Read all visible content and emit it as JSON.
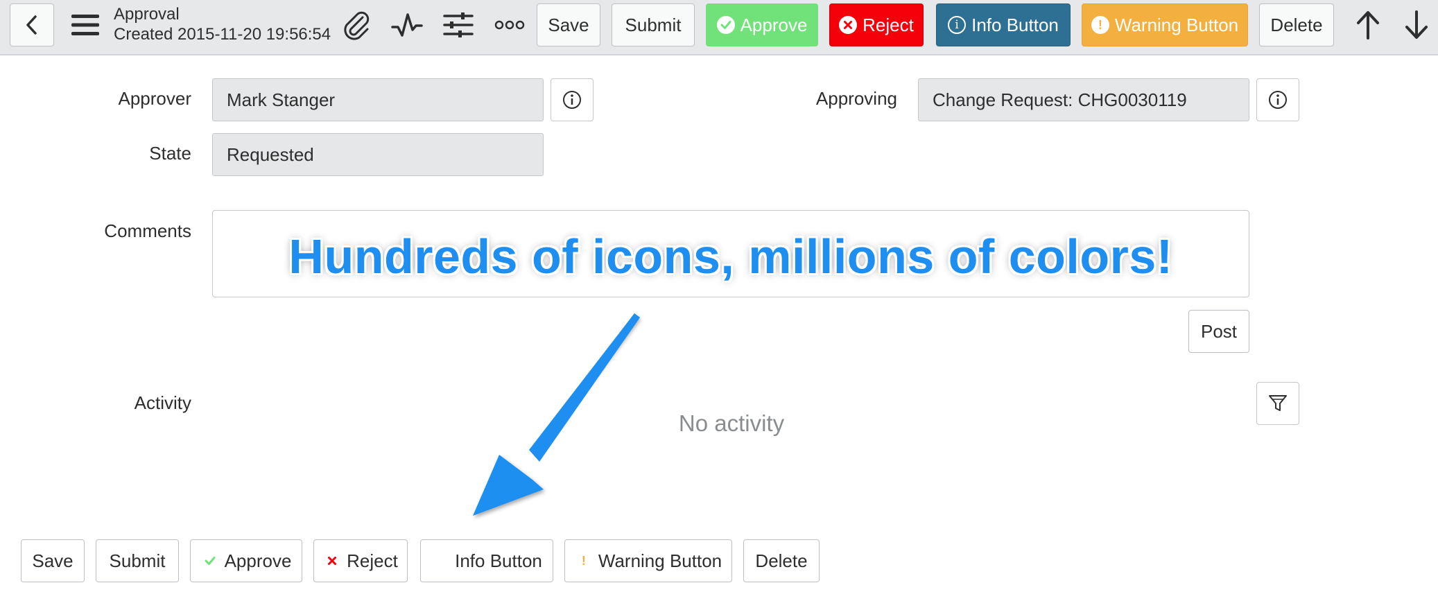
{
  "header": {
    "title": "Approval",
    "subtitle": "Created 2015-11-20 19:56:54",
    "buttons": {
      "save": "Save",
      "submit": "Submit",
      "approve": "Approve",
      "reject": "Reject",
      "info": "Info Button",
      "warning": "Warning Button",
      "delete": "Delete"
    },
    "icons": [
      "back-icon",
      "menu-icon",
      "paperclip-icon",
      "activity-icon",
      "settings-sliders-icon",
      "more-icon",
      "up-arrow-icon",
      "down-arrow-icon"
    ]
  },
  "form": {
    "approver_label": "Approver",
    "approver_value": "Mark Stanger",
    "approving_label": "Approving",
    "approving_value": "Change Request: CHG0030119",
    "state_label": "State",
    "state_value": "Requested",
    "comments_label": "Comments",
    "post_button": "Post",
    "activity_label": "Activity",
    "no_activity": "No activity"
  },
  "overlay": {
    "caption": "Hundreds of icons, millions of colors!"
  },
  "footer": {
    "buttons": {
      "save": "Save",
      "submit": "Submit",
      "approve": "Approve",
      "reject": "Reject",
      "info": "Info Button",
      "warning": "Warning Button",
      "delete": "Delete"
    }
  },
  "colors": {
    "approve": "#71e279",
    "reject": "#f4000b",
    "info": "#2d7094",
    "warning": "#f3b03f",
    "caption": "#1e8ff0",
    "header_bg": "#e6e8ea"
  }
}
